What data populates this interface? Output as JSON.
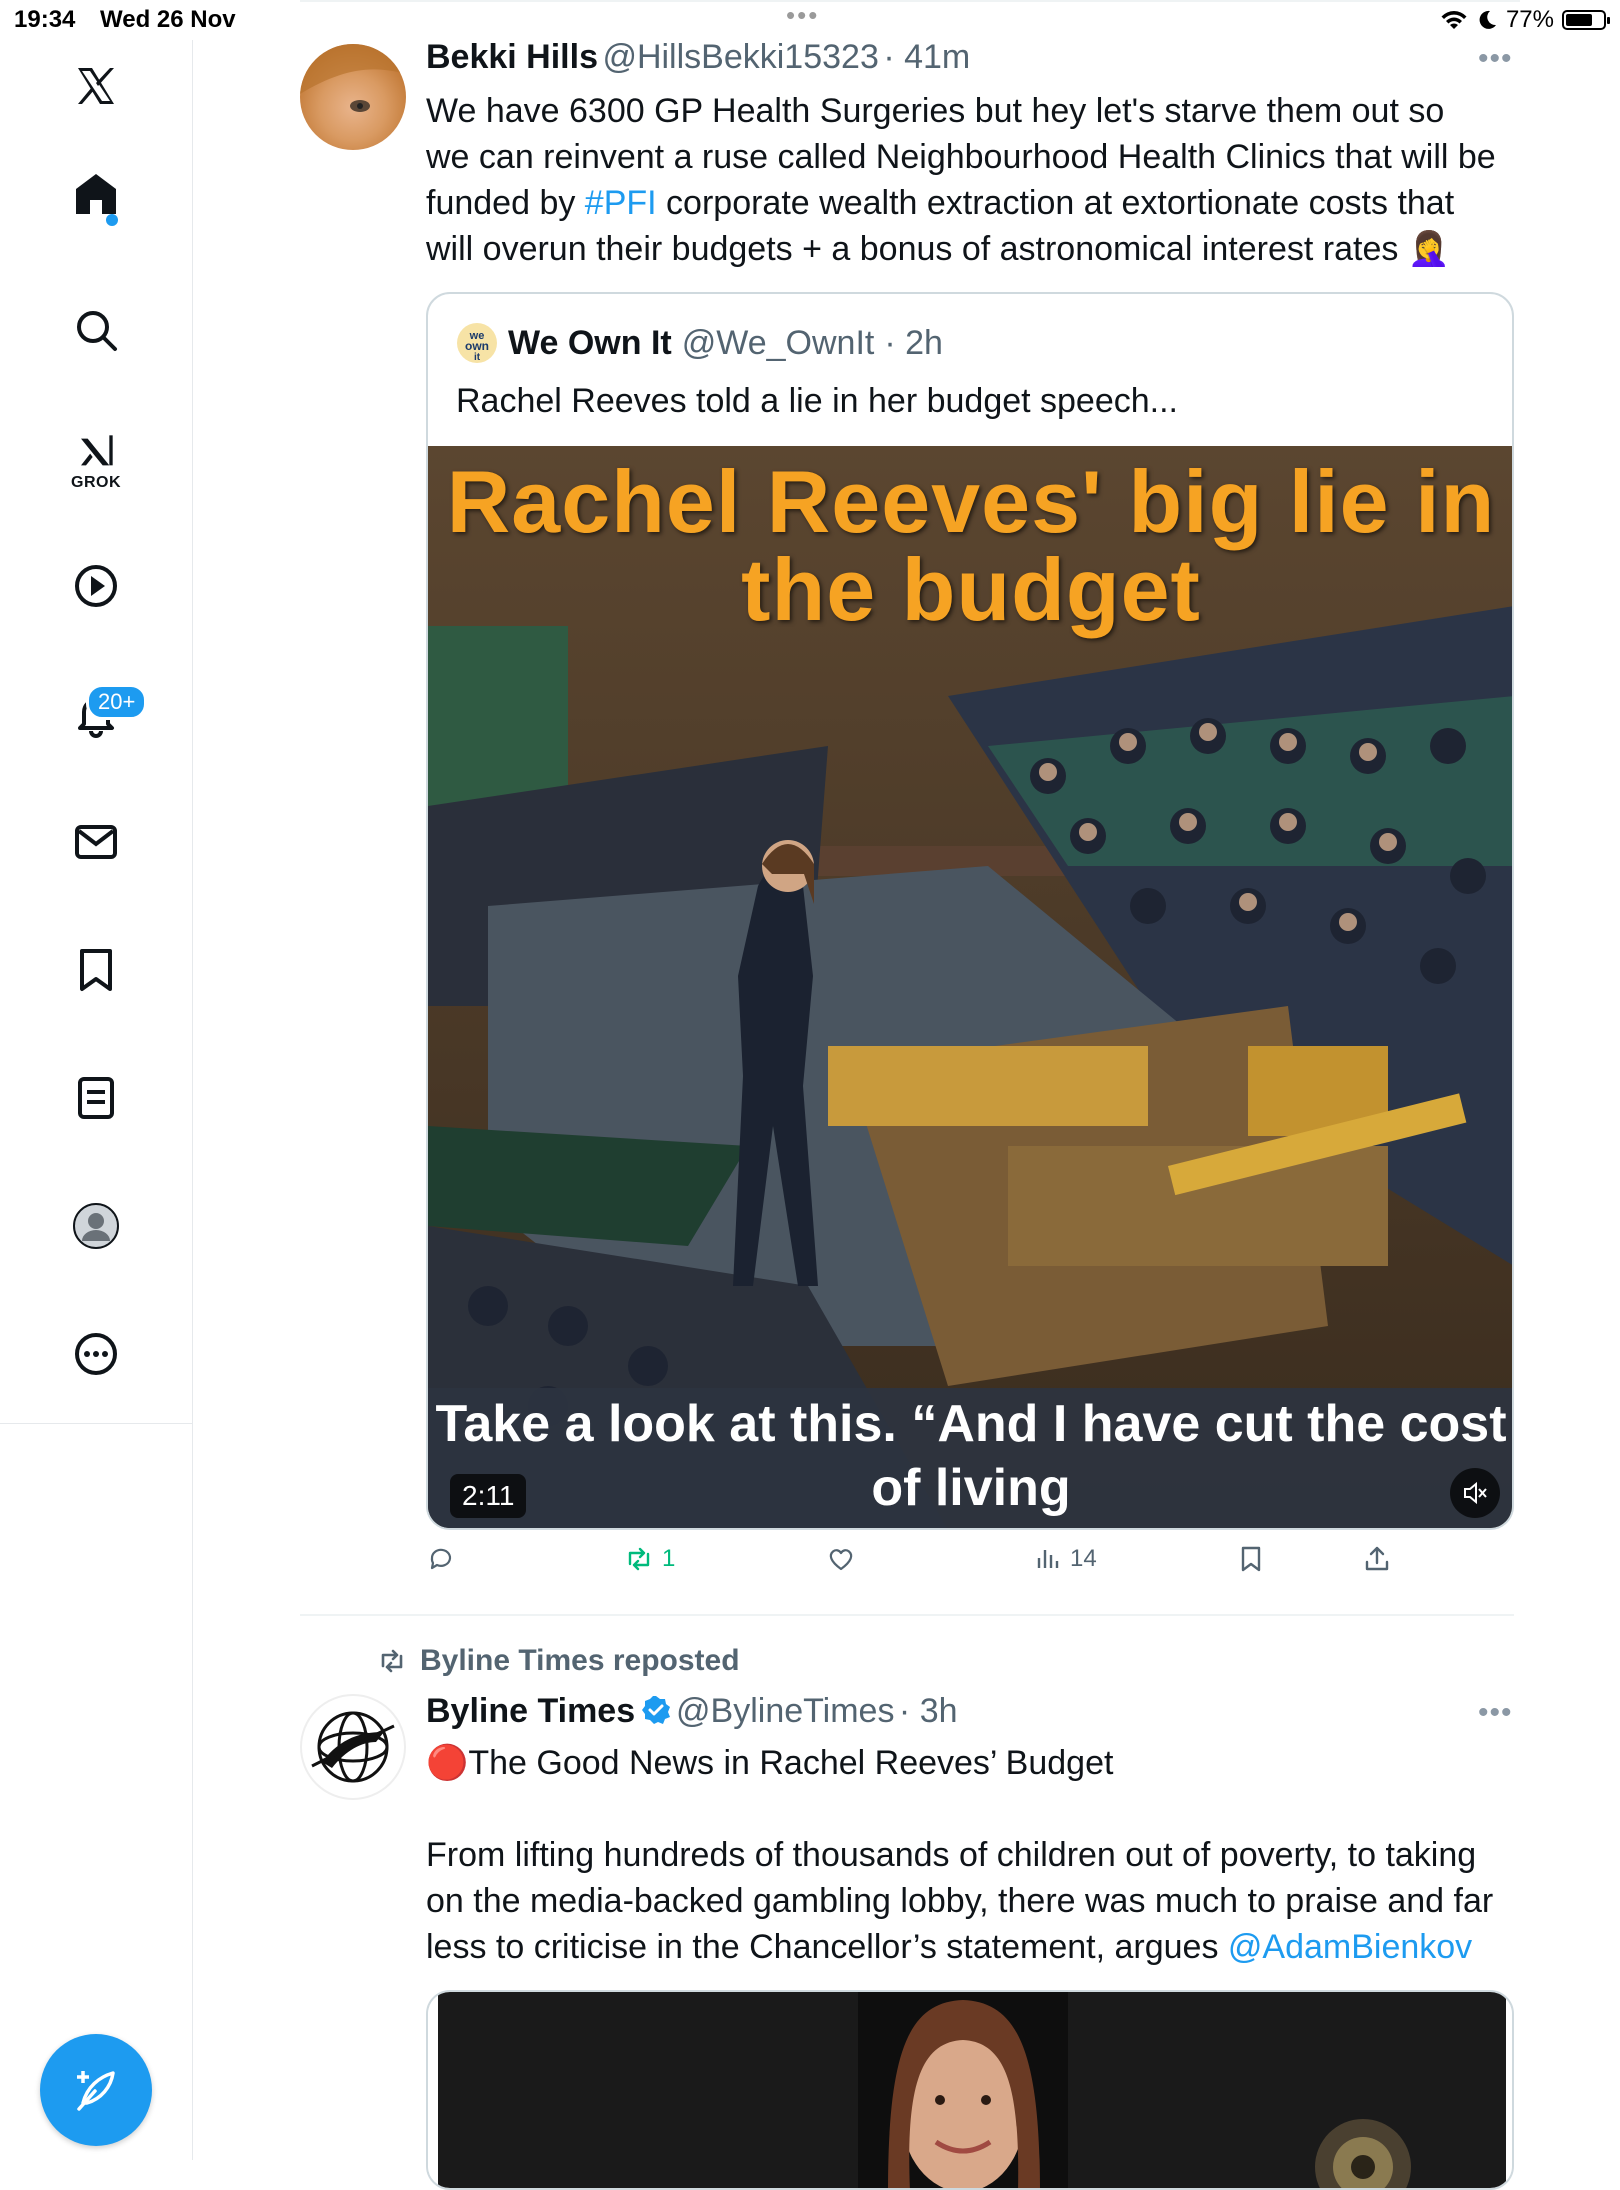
{
  "status_bar": {
    "time": "19:34",
    "date": "Wed 26 Nov",
    "battery": "77%",
    "battery_level": 0.77
  },
  "sidebar": {
    "notifications_badge": "20+",
    "grok_label": "GROK"
  },
  "tweets": [
    {
      "name": "Bekki Hills",
      "handle": "@HillsBekki15323",
      "time": "· 41m",
      "text_parts": [
        "We have 6300 GP Health Surgeries but hey let's starve them out so we can reinvent a ruse called Neighbourhood Health Clinics that will be funded by ",
        "#PFI",
        " corporate wealth extraction at extortionate costs that will overun their budgets + a bonus of astronomical interest rates 🤦‍♀️"
      ],
      "quote": {
        "name": "We Own It",
        "handle": "@We_OwnIt",
        "time": "· 2h",
        "text": "Rachel Reeves told a lie in her budget speech...",
        "video_title": "Rachel Reeves' big lie in the budget",
        "caption": "Take a look at this. “And I have cut the cost of living",
        "duration": "2:11"
      },
      "actions": {
        "reply": "",
        "repost": "1",
        "like": "",
        "views": "14"
      }
    },
    {
      "reposted_by": "Byline Times reposted",
      "name": "Byline Times",
      "handle": "@BylineTimes",
      "time": "· 3h",
      "headline": "🔴The Good News in Rachel Reeves’ Budget",
      "text_parts": [
        "From lifting hundreds of thousands of children out of poverty, to taking on the media-backed gambling lobby, there was much to praise and far less to criticise in the Chancellor’s statement, argues ",
        "@AdamBienkov"
      ]
    }
  ],
  "colors": {
    "accent": "#1d9bf0",
    "repost_green": "#00ba7c",
    "title_orange": "#f6a323"
  }
}
